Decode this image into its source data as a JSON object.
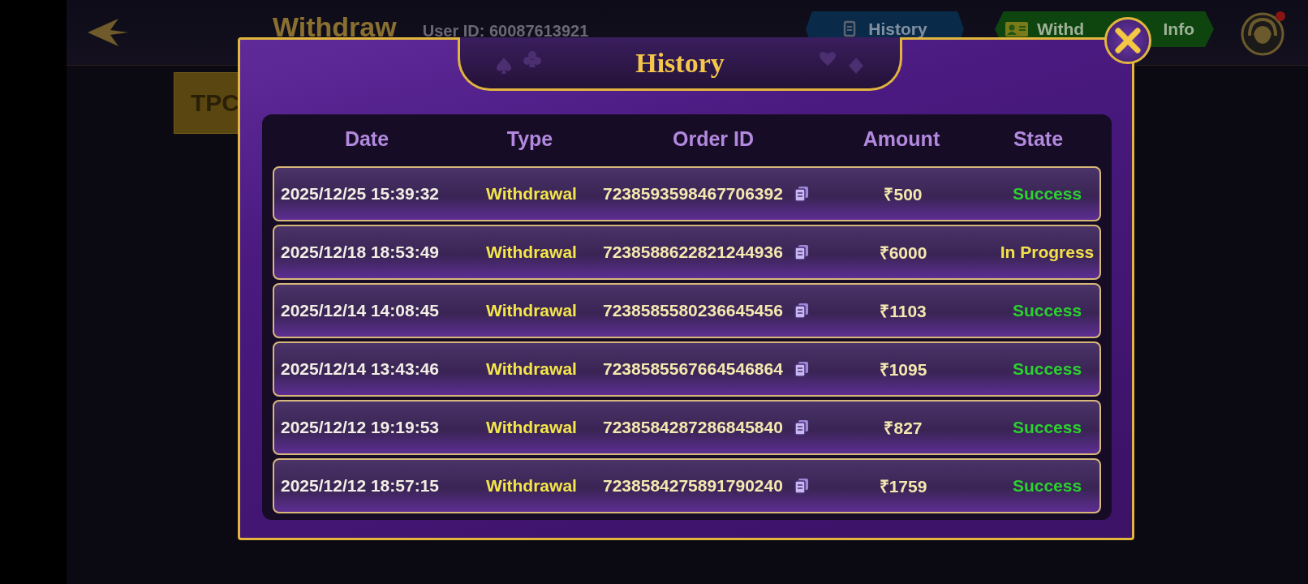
{
  "header": {
    "title": "Withdraw",
    "user_id": "User ID: 60087613921",
    "tabs": [
      {
        "label": "History",
        "kind": "history",
        "selected": false
      },
      {
        "label": "Withd",
        "label_end": "Info",
        "kind": "info",
        "selected": true
      }
    ]
  },
  "side_button": "TPC",
  "dialog": {
    "title": "History",
    "columns": [
      "Date",
      "Type",
      "Order ID",
      "Amount",
      "State"
    ],
    "rows": [
      {
        "date": "2025/12/25 15:39:32",
        "type": "Withdrawal",
        "order_id": "7238593598467706392",
        "amount": "₹500",
        "state": "Success",
        "color": "#2bd12f"
      },
      {
        "date": "2025/12/18 18:53:49",
        "type": "Withdrawal",
        "order_id": "7238588622821244936",
        "amount": "₹6000",
        "state": "In Progress",
        "color": "#f3e04a"
      },
      {
        "date": "2025/12/14 14:08:45",
        "type": "Withdrawal",
        "order_id": "7238585580236645456",
        "amount": "₹1103",
        "state": "Success",
        "color": "#2bd12f"
      },
      {
        "date": "2025/12/14 13:43:46",
        "type": "Withdrawal",
        "order_id": "7238585567664546864",
        "amount": "₹1095",
        "state": "Success",
        "color": "#2bd12f"
      },
      {
        "date": "2025/12/12 19:19:53",
        "type": "Withdrawal",
        "order_id": "7238584287286845840",
        "amount": "₹827",
        "state": "Success",
        "color": "#2bd12f"
      },
      {
        "date": "2025/12/12 18:57:15",
        "type": "Withdrawal",
        "order_id": "7238584275891790240",
        "amount": "₹1759",
        "state": "Success",
        "color": "#2bd12f"
      }
    ]
  }
}
